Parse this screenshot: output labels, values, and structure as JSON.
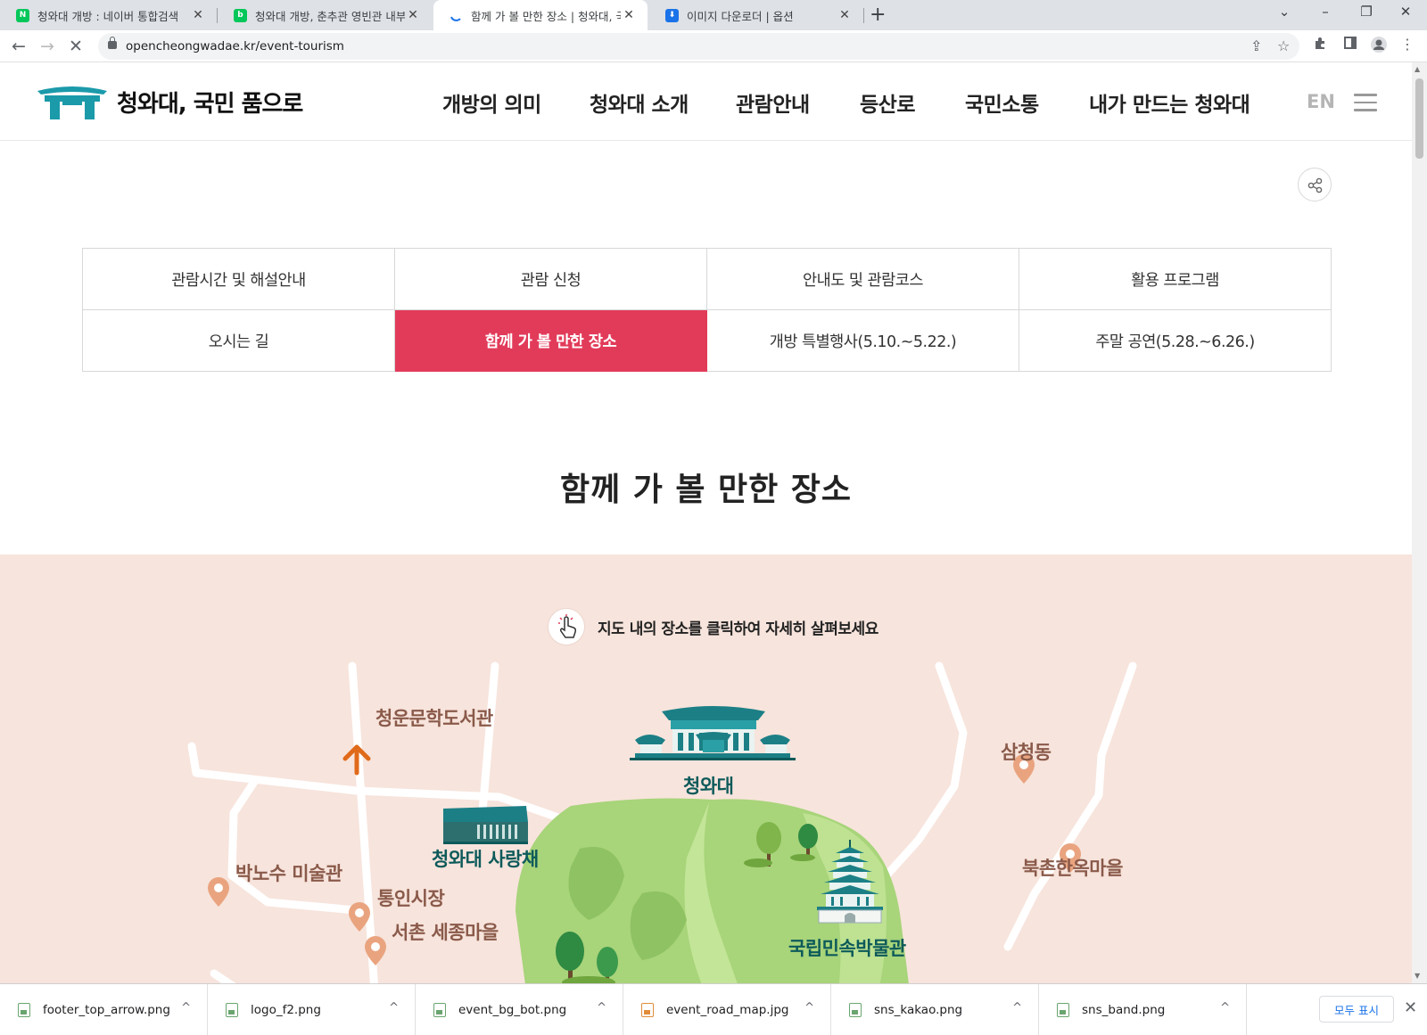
{
  "browser": {
    "tabs": [
      {
        "title": "청와대 개방 : 네이버 통합검색",
        "favicon": "naver-icon",
        "favicon_color": "#03c75a"
      },
      {
        "title": "청와대 개방, 춘추관 영빈관 내부",
        "favicon": "blog-icon",
        "favicon_color": "#03c75a"
      },
      {
        "title": "함께 가 볼 만한 장소 | 청와대, 국",
        "favicon": "loading-spinner-icon",
        "favicon_color": "#1a73e8"
      },
      {
        "title": "이미지 다운로더 | 옵션",
        "favicon": "download-icon",
        "favicon_color": "#1a73e8"
      }
    ],
    "url": "opencheongwadae.kr/event-tourism"
  },
  "site": {
    "logo_text": "청와대, 국민 품으로",
    "gnb": [
      "개방의 의미",
      "청와대 소개",
      "관람안내",
      "등산로",
      "국민소통",
      "내가 만드는 청와대"
    ],
    "lang": "EN",
    "accent_color": "#e23b5a"
  },
  "subnav": [
    {
      "label": "관람시간 및 해설안내",
      "active": false
    },
    {
      "label": "관람 신청",
      "active": false
    },
    {
      "label": "안내도 및 관람코스",
      "active": false
    },
    {
      "label": "활용 프로그램",
      "active": false
    },
    {
      "label": "오시는 길",
      "active": false
    },
    {
      "label": "함께 가 볼 만한 장소",
      "active": true
    },
    {
      "label": "개방 특별행사(5.10.~5.22.)",
      "active": false
    },
    {
      "label": "주말 공연(5.28.~6.26.)",
      "active": false
    }
  ],
  "page_title": "함께 가 볼 만한 장소",
  "map": {
    "hint": "지도 내의 장소를 클릭하여 자세히 살펴보세요",
    "places": {
      "library": "청운문학도서관",
      "cheongwadae": "청와대",
      "samcheong": "삼청동",
      "sarangchae": "청와대 사랑채",
      "bukchon": "북촌한옥마을",
      "parknosu": "박노수 미술관",
      "tongin": "통인시장",
      "seochon": "서촌 세종마을",
      "folk_museum": "국립민속박물관"
    }
  },
  "downloads": [
    {
      "name": "footer_top_arrow.png",
      "type": "png"
    },
    {
      "name": "logo_f2.png",
      "type": "png"
    },
    {
      "name": "event_bg_bot.png",
      "type": "png"
    },
    {
      "name": "event_road_map.jpg",
      "type": "jpg"
    },
    {
      "name": "sns_kakao.png",
      "type": "png"
    },
    {
      "name": "sns_band.png",
      "type": "png"
    }
  ],
  "downloads_show_all": "모두 표시"
}
